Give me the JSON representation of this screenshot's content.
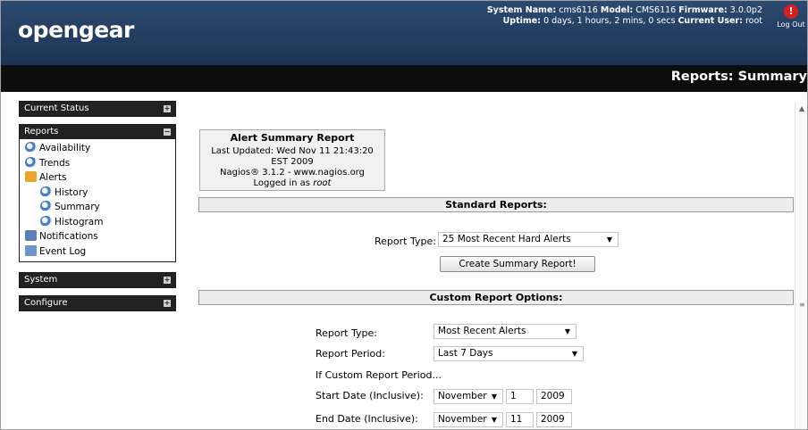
{
  "header": {
    "logo": "opengear",
    "system_name_label": "System Name:",
    "system_name": "cms6116",
    "model_label": "Model:",
    "model": "CMS6116",
    "firmware_label": "Firmware:",
    "firmware": "3.0.0p2",
    "uptime_label": "Uptime:",
    "uptime": "0 days, 1 hours, 2 mins, 0 secs",
    "user_label": "Current User:",
    "user": "root",
    "logout_label": "Log Out",
    "logout_icon": "power-icon"
  },
  "page_title": "Reports: Summary",
  "sidebar": {
    "current_status": "Current Status",
    "reports": "Reports",
    "system": "System",
    "configure": "Configure",
    "expand_symbol": "+",
    "collapse_symbol": "−",
    "report_items": [
      {
        "label": "Availability",
        "icon": "globe-icon"
      },
      {
        "label": "Trends",
        "icon": "globe-icon"
      },
      {
        "label": "Alerts",
        "icon": "folder-icon"
      },
      {
        "label": "History",
        "icon": "globe-icon"
      },
      {
        "label": "Summary",
        "icon": "globe-icon"
      },
      {
        "label": "Histogram",
        "icon": "globe-icon"
      },
      {
        "label": "Notifications",
        "icon": "speaker-icon"
      },
      {
        "label": "Event Log",
        "icon": "notepad-icon"
      }
    ]
  },
  "report_box": {
    "title": "Alert Summary Report",
    "last_updated": "Last Updated: Wed Nov 11 21:43:20 EST 2009",
    "nagios": "Nagios® 3.1.2 - www.nagios.org",
    "logged_in_prefix": "Logged in as ",
    "logged_in_user": "root"
  },
  "standard": {
    "header": "Standard Reports:",
    "report_type_label": "Report Type:",
    "report_type_value": "25 Most Recent Hard Alerts",
    "create_button": "Create Summary Report!"
  },
  "custom": {
    "header": "Custom Report Options:",
    "report_type_label": "Report Type:",
    "report_type_value": "Most Recent Alerts",
    "report_period_label": "Report Period:",
    "report_period_value": "Last 7 Days",
    "custom_period_note": "If Custom Report Period...",
    "start_label": "Start Date (Inclusive):",
    "start_month": "November",
    "start_day": "1",
    "start_year": "2009",
    "end_label": "End Date (Inclusive):",
    "end_month": "November",
    "end_day": "11",
    "end_year": "2009"
  },
  "colors": {
    "header_bg": "#23406a",
    "titlebar_bg": "#0d0d0d",
    "sidebar_header_bg": "#222222"
  }
}
